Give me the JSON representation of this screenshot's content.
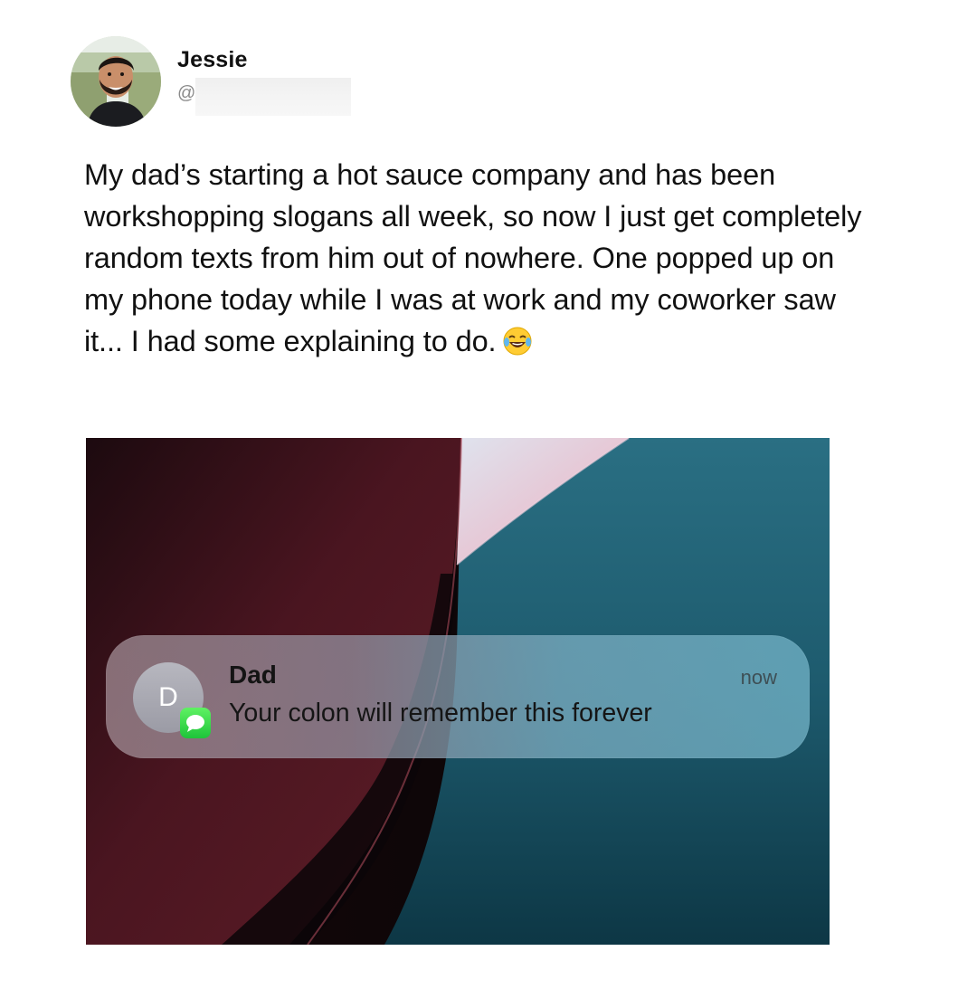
{
  "post": {
    "display_name": "Jessie",
    "handle_prefix": "@",
    "text": "My dad’s starting a hot sauce company and has been workshopping slogans all week, so now I just get completely random texts from him out of nowhere. One popped up on my phone today while I was at work and my coworker saw it... I had some explaining to do.",
    "emoji": "face-with-tears-of-joy"
  },
  "notification": {
    "sender": "Dad",
    "avatar_letter": "D",
    "message": "Your colon will remember this forever",
    "time": "now",
    "app_icon": "messages-icon"
  },
  "colors": {
    "notification_time": "#3e4f55",
    "messages_green": "#2fd24a",
    "wallpaper_red": "#5a1a22",
    "wallpaper_teal": "#1f5f72"
  }
}
